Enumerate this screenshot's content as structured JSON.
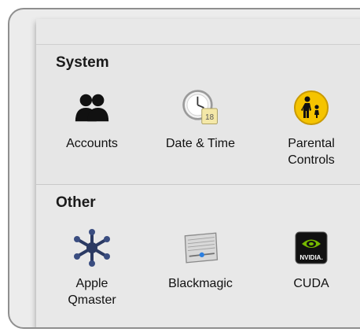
{
  "sections": {
    "system": {
      "title": "System",
      "items": [
        {
          "label": "Accounts",
          "icon": "accounts-icon"
        },
        {
          "label": "Date & Time",
          "icon": "date-time-icon",
          "calendar_day": "18"
        },
        {
          "label": "Parental\nControls",
          "icon": "parental-controls-icon"
        }
      ]
    },
    "other": {
      "title": "Other",
      "items": [
        {
          "label": "Apple\nQmaster",
          "icon": "qmaster-icon"
        },
        {
          "label": "Blackmagic",
          "icon": "blackmagic-icon"
        },
        {
          "label": "CUDA",
          "icon": "cuda-icon",
          "badge_text": "NVIDIA."
        }
      ]
    }
  },
  "colors": {
    "parental_badge": "#f5c400",
    "cuda_green": "#76b900",
    "qmaster_navy": "#2b3a63"
  }
}
